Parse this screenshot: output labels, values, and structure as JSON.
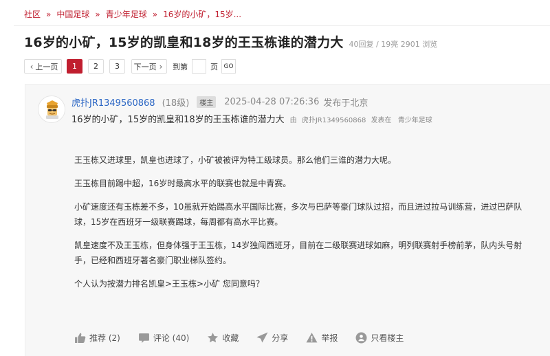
{
  "breadcrumb": {
    "items": [
      "社区",
      "中国足球",
      "青少年足球",
      "16岁的小矿，15岁..."
    ],
    "separator": "»"
  },
  "thread": {
    "title": "16岁的小矿，15岁的凯皇和18岁的王玉栋谁的潜力大",
    "stats": "40回复 / 19亮 2901 浏览"
  },
  "pagination": {
    "prev_label": "上一页",
    "pages": [
      "1",
      "2",
      "3"
    ],
    "current_page": "1",
    "next_label": "下一页",
    "goto_prefix": "到第",
    "goto_suffix": "页",
    "go_label": "GO"
  },
  "post": {
    "author": "虎扑JR1349560868",
    "level": "(18级)",
    "badge": "楼主",
    "time": "2025-04-28 07:26:36",
    "location": "发布于北京",
    "subtitle": "16岁的小矿，15岁的凯皇和18岁的王玉栋谁的潜力大",
    "sub_by": "由",
    "sub_author": "虎扑JR1349560868",
    "sub_posted_in": "发表在",
    "sub_forum": "青少年足球",
    "paragraphs": [
      "王玉栋又进球里，凯皇也进球了，小矿被被评为特工级球员。那么他们三谁的潜力大呢。",
      "王玉栋目前踢中超，16岁时最高水平的联赛也就是中青赛。",
      "小矿速度还有玉栋差不多，10虽就开始踢高水平国际比赛，多次与巴萨等豪门球队过招，而且进过拉马训练营，进过巴萨队球，15岁在西班牙一级联赛踢球，每周都有高水平比赛。",
      "凯皇速度不及王玉栋，但身体强于王玉栋，14岁独闯西班牙，目前在二级联赛进球如麻，明列联赛射手榜前茅，队内头号射手，已经和西班牙著名豪门职业梯队签约。",
      "个人认为按潜力排名凯皇>王玉栋>小矿  您同意吗？"
    ]
  },
  "actions": {
    "recommend": "推荐 (2)",
    "comment": "评论 (40)",
    "favorite": "收藏",
    "share": "分享",
    "report": "举报",
    "only_owner": "只看楼主"
  },
  "colors": {
    "accent": "#c01e2f",
    "link": "#2b66c4",
    "card_bg": "#f7f7f7"
  },
  "icons": [
    "chevron-left-icon",
    "chevron-right-icon",
    "avatar-icon",
    "thumbs-up-icon",
    "comment-icon",
    "star-icon",
    "send-icon",
    "warning-icon",
    "only-owner-icon"
  ]
}
